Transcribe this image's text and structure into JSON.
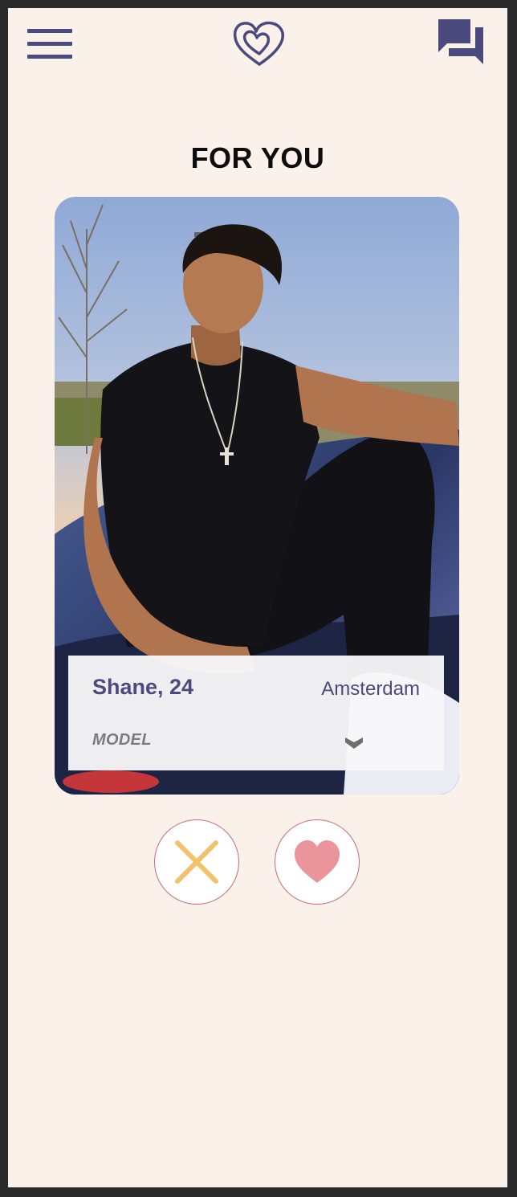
{
  "header": {
    "menu_icon": "hamburger-menu-icon",
    "logo_icon": "double-heart-logo-icon",
    "chat_icon": "chat-bubbles-icon"
  },
  "page": {
    "title": "FOR YOU"
  },
  "profile_card": {
    "photo": "profile-photo",
    "name_age": "Shane, 24",
    "city": "Amsterdam",
    "profession": "MODEL",
    "expand_icon": "chevron-down-icon"
  },
  "actions": {
    "reject_icon": "close-x-icon",
    "like_icon": "heart-icon"
  },
  "colors": {
    "background": "#faf1ea",
    "brand_purple": "#4a4a7f",
    "reject_yellow": "#efc26b",
    "like_pink": "#e9959b",
    "button_border": "#c86a72"
  }
}
